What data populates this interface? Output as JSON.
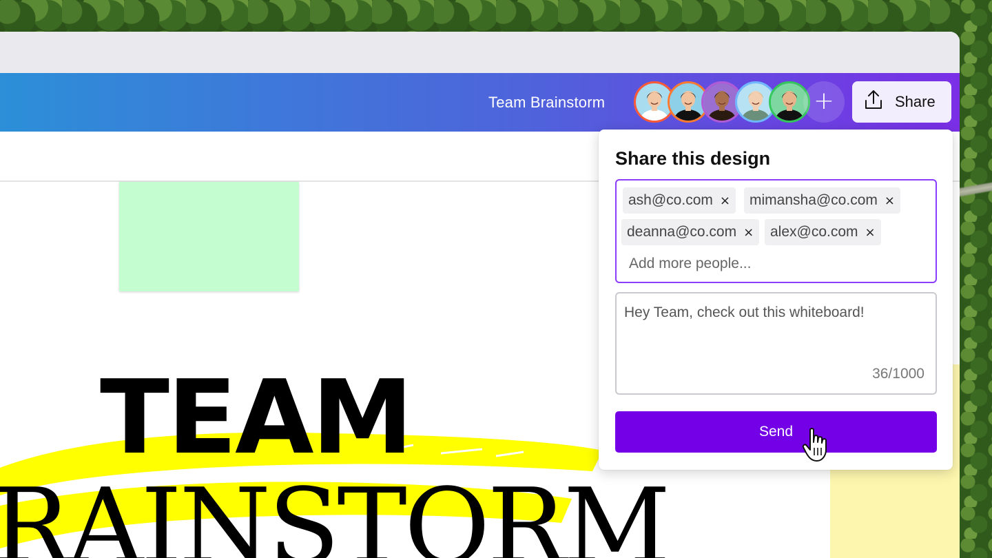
{
  "header": {
    "design_title": "Team Brainstorm",
    "share_label": "Share",
    "add_collaborator_symbol": "+",
    "avatars": [
      {
        "name": "avatar-1",
        "ring": "#ff5a36",
        "bg": "#a9dcee",
        "skin": "#f2c7a5",
        "hair": "#151515",
        "shirt": "#ffffff"
      },
      {
        "name": "avatar-2",
        "ring": "#ff7a2f",
        "bg": "#8fd0e9",
        "skin": "#f1c39e",
        "hair": "#1a1a1a",
        "shirt": "#111111"
      },
      {
        "name": "avatar-3",
        "ring": "#b25bd6",
        "bg": "#9b6fd1",
        "skin": "#a86f4d",
        "hair": "#1a0f0a",
        "shirt": "#2a1a10"
      },
      {
        "name": "avatar-4",
        "ring": "#6fb8ff",
        "bg": "#b7e2f4",
        "skin": "#f3cfb2",
        "hair": "#d8a96a",
        "shirt": "#6a8f7a"
      },
      {
        "name": "avatar-5",
        "ring": "#34c759",
        "bg": "#7ed6a1",
        "skin": "#e7b58c",
        "hair": "#141414",
        "shirt": "#111111"
      }
    ]
  },
  "canvas": {
    "headline_top": "TEAM",
    "headline_bottom": "RAINSTORM"
  },
  "share_panel": {
    "title": "Share this design",
    "recipients": [
      {
        "email": "ash@co.com"
      },
      {
        "email": "mimansha@co.com"
      },
      {
        "email": "deanna@co.com"
      },
      {
        "email": "alex@co.com"
      }
    ],
    "remove_symbol": "×",
    "add_placeholder": "Add more people...",
    "message": "Hey Team, check out this whiteboard!",
    "char_count": "36/1000",
    "send_label": "Send"
  },
  "colors": {
    "brand_purple": "#7300e6",
    "focus_border": "#8b3dff",
    "sticky_green": "#c4fdd0",
    "sticky_yellow": "#fdf6ae",
    "highlight_yellow": "#ffff00"
  },
  "icons": {
    "share": "upload-share-icon",
    "cursor": "hand-pointer-icon"
  }
}
